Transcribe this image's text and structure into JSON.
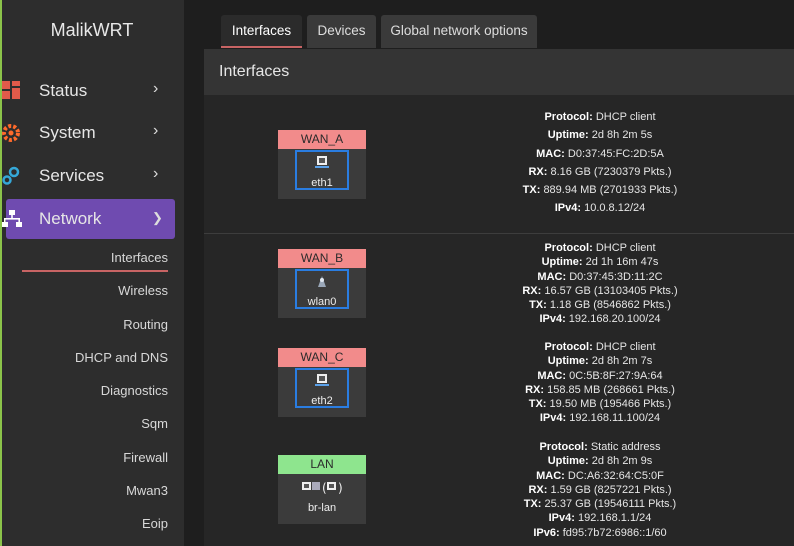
{
  "brand": "MalikWRT",
  "nav": {
    "status": "Status",
    "system": "System",
    "services": "Services",
    "network": "Network"
  },
  "subnav": [
    "Interfaces",
    "Wireless",
    "Routing",
    "DHCP and DNS",
    "Diagnostics",
    "Sqm",
    "Firewall",
    "Mwan3",
    "Eoip"
  ],
  "tabs": [
    "Interfaces",
    "Devices",
    "Global network options"
  ],
  "panel_title": "Interfaces",
  "colors": {
    "wan_header": "#f28b8b",
    "lan_header": "#8ee58e",
    "active_nav": "#6f4bb0",
    "device_outline": "#2a7de1"
  },
  "interfaces": [
    {
      "name": "WAN_A",
      "device": "eth1",
      "protocol_label": "Protocol:",
      "protocol": "DHCP client",
      "uptime_label": "Uptime:",
      "uptime": "2d 8h 2m 5s",
      "mac_label": "MAC:",
      "mac": "D0:37:45:FC:2D:5A",
      "rx_label": "RX:",
      "rx": "8.16 GB (7230379 Pkts.)",
      "tx_label": "TX:",
      "tx": "889.94 MB (2701933 Pkts.)",
      "ipv4_label": "IPv4:",
      "ipv4": "10.0.8.12/24"
    },
    {
      "name": "WAN_B",
      "device": "wlan0",
      "protocol_label": "Protocol:",
      "protocol": "DHCP client",
      "uptime_label": "Uptime:",
      "uptime": "2d 1h 16m 47s",
      "mac_label": "MAC:",
      "mac": "D0:37:45:3D:11:2C",
      "rx_label": "RX:",
      "rx": "16.57 GB (13103405 Pkts.)",
      "tx_label": "TX:",
      "tx": "1.18 GB (8546862 Pkts.)",
      "ipv4_label": "IPv4:",
      "ipv4": "192.168.20.100/24"
    },
    {
      "name": "WAN_C",
      "device": "eth2",
      "protocol_label": "Protocol:",
      "protocol": "DHCP client",
      "uptime_label": "Uptime:",
      "uptime": "2d 8h 2m 7s",
      "mac_label": "MAC:",
      "mac": "0C:5B:8F:27:9A:64",
      "rx_label": "RX:",
      "rx": "158.85 MB (268661 Pkts.)",
      "tx_label": "TX:",
      "tx": "19.50 MB (195466 Pkts.)",
      "ipv4_label": "IPv4:",
      "ipv4": "192.168.11.100/24"
    },
    {
      "name": "LAN",
      "device": "br-lan",
      "protocol_label": "Protocol:",
      "protocol": "Static address",
      "uptime_label": "Uptime:",
      "uptime": "2d 8h 2m 9s",
      "mac_label": "MAC:",
      "mac": "DC:A6:32:64:C5:0F",
      "rx_label": "RX:",
      "rx": "1.59 GB (8257221 Pkts.)",
      "tx_label": "TX:",
      "tx": "25.37 GB (19546111 Pkts.)",
      "ipv4_label": "IPv4:",
      "ipv4": "192.168.1.1/24",
      "ipv6_label": "IPv6:",
      "ipv6": "fd95:7b72:6986::1/60"
    }
  ]
}
